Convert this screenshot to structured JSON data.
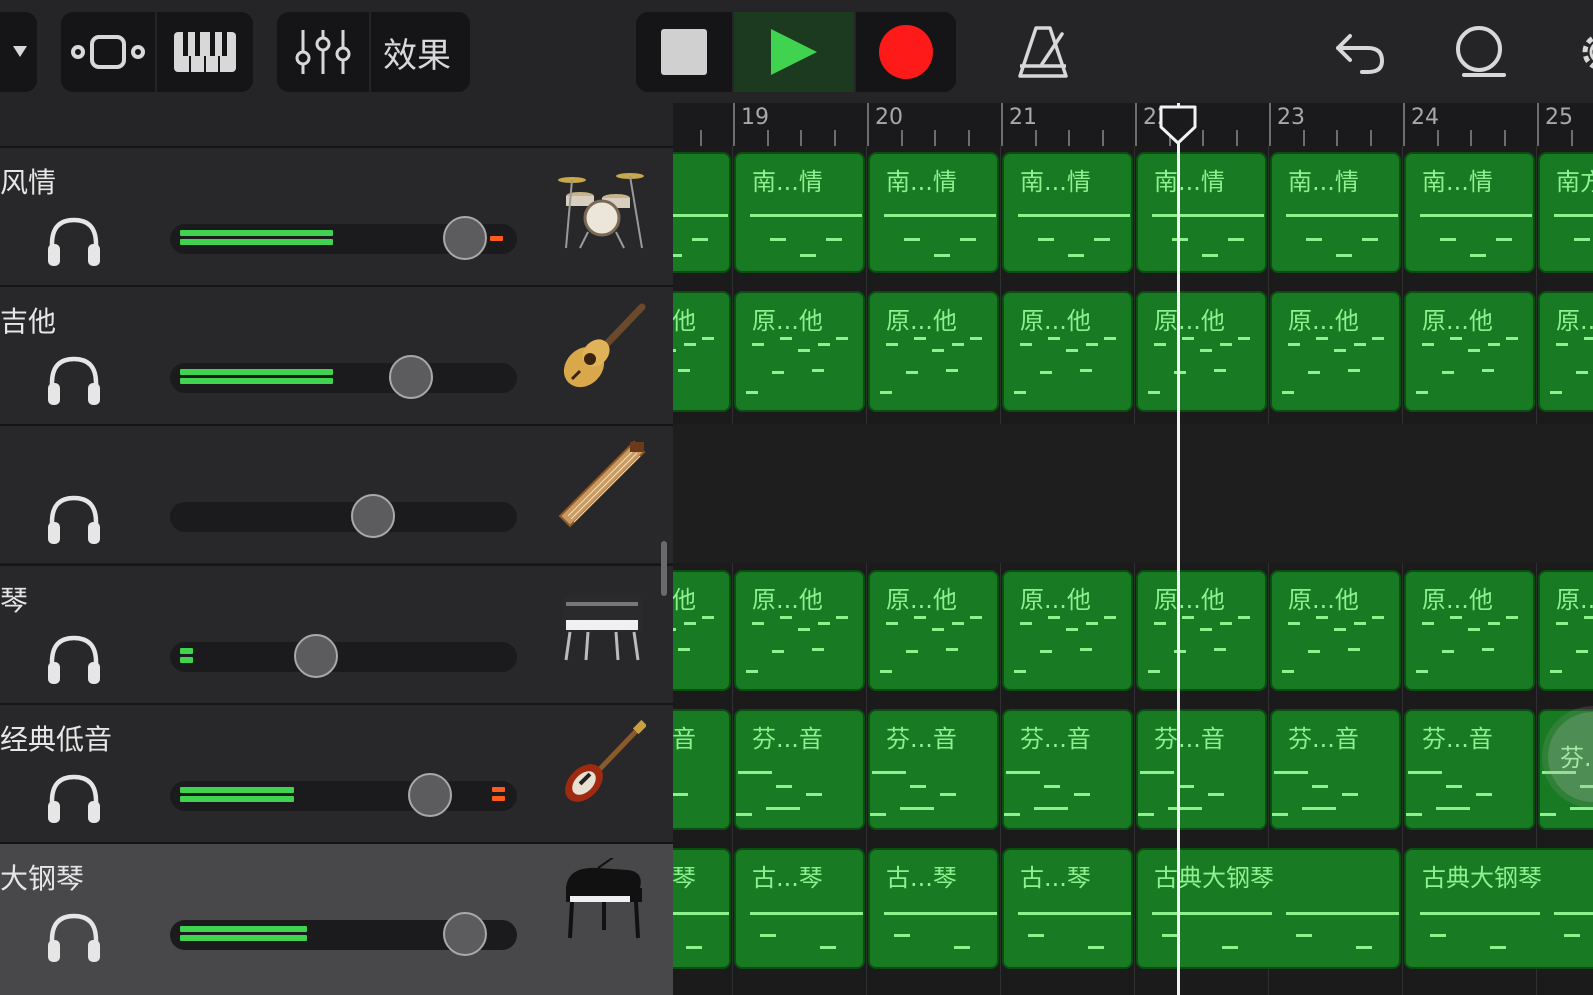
{
  "toolbar": {
    "effects_label": "效果"
  },
  "ruler": {
    "bars": [
      "19",
      "20",
      "21",
      "22",
      "23",
      "24",
      "25"
    ]
  },
  "tracks": [
    {
      "name": "风情",
      "instrument_icon": "drum-kit-icon",
      "meter_level": 0.47,
      "volume_level": 0.93,
      "clipping": true
    },
    {
      "name": "吉他",
      "instrument_icon": "acoustic-guitar-icon",
      "meter_level": 0.47,
      "volume_level": 0.76,
      "clipping": false
    },
    {
      "name": "",
      "instrument_icon": "guzheng-icon",
      "meter_level": 0.0,
      "volume_level": 0.64,
      "clipping": false
    },
    {
      "name": "琴",
      "instrument_icon": "electric-piano-icon",
      "meter_level": 0.04,
      "volume_level": 0.46,
      "clipping": false
    },
    {
      "name": "经典低音",
      "instrument_icon": "bass-guitar-icon",
      "meter_level": 0.35,
      "volume_level": 0.82,
      "clipping": true
    },
    {
      "name": "大钢琴",
      "instrument_icon": "grand-piano-icon",
      "meter_level": 0.39,
      "volume_level": 0.93,
      "clipping": false
    }
  ],
  "regions": [
    [
      "",
      "南...情",
      "南...情",
      "南...情",
      "南...情",
      "南...情",
      "南...情",
      "南方"
    ],
    [
      "他",
      "原...他",
      "原...他",
      "原...他",
      "原...他",
      "原...他",
      "原...他",
      "原..."
    ],
    [],
    [
      "他",
      "原...他",
      "原...他",
      "原...他",
      "原...他",
      "原...他",
      "原...他",
      "原..."
    ],
    [
      "音",
      "芬...音",
      "芬...音",
      "芬...音",
      "芬...音",
      "芬...音",
      "芬...音",
      ""
    ],
    [
      "琴",
      "古...琴",
      "古...琴",
      "古...琴",
      "古典大钢琴",
      "古典大钢琴"
    ]
  ],
  "floating_button": {
    "label": "芬..."
  },
  "colors": {
    "region_green": "#187a22",
    "note_green": "#8cf38c",
    "play_green": "#3fd34f",
    "record_red": "#ff1a1a"
  }
}
